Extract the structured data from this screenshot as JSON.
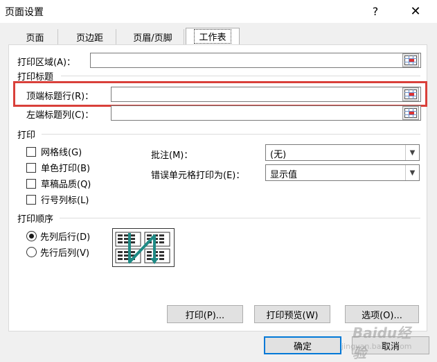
{
  "window": {
    "title": "页面设置",
    "help": "?",
    "close": "✕"
  },
  "tabs": [
    {
      "label": "页面"
    },
    {
      "label": "页边距"
    },
    {
      "label": "页眉/页脚"
    },
    {
      "label": "工作表",
      "active": true
    }
  ],
  "print_area": {
    "label": "打印区域(A)：",
    "value": ""
  },
  "print_titles": {
    "group": "打印标题",
    "rows_label": "顶端标题行(R)：",
    "rows_value": "",
    "cols_label": "左端标题列(C)：",
    "cols_value": ""
  },
  "print": {
    "group": "打印",
    "checkboxes": [
      {
        "label": "网格线(G)",
        "checked": false
      },
      {
        "label": "单色打印(B)",
        "checked": false
      },
      {
        "label": "草稿品质(Q)",
        "checked": false
      },
      {
        "label": "行号列标(L)",
        "checked": false
      }
    ],
    "comments_label": "批注(M)：",
    "comments_value": "(无)",
    "errors_label": "错误单元格打印为(E)：",
    "errors_value": "显示值"
  },
  "page_order": {
    "group": "打印顺序",
    "options": [
      {
        "label": "先列后行(D)",
        "selected": true
      },
      {
        "label": "先行后列(V)",
        "selected": false
      }
    ]
  },
  "buttons": {
    "print": "打印(P)...",
    "preview": "打印预览(W)",
    "options": "选项(O)...",
    "ok": "确定",
    "cancel": "取消"
  },
  "watermark": {
    "main": "Baidu经验",
    "sub": "jingyan.baidu.com"
  },
  "colors": {
    "highlight": "#d9403a",
    "accent": "#0078d7"
  }
}
